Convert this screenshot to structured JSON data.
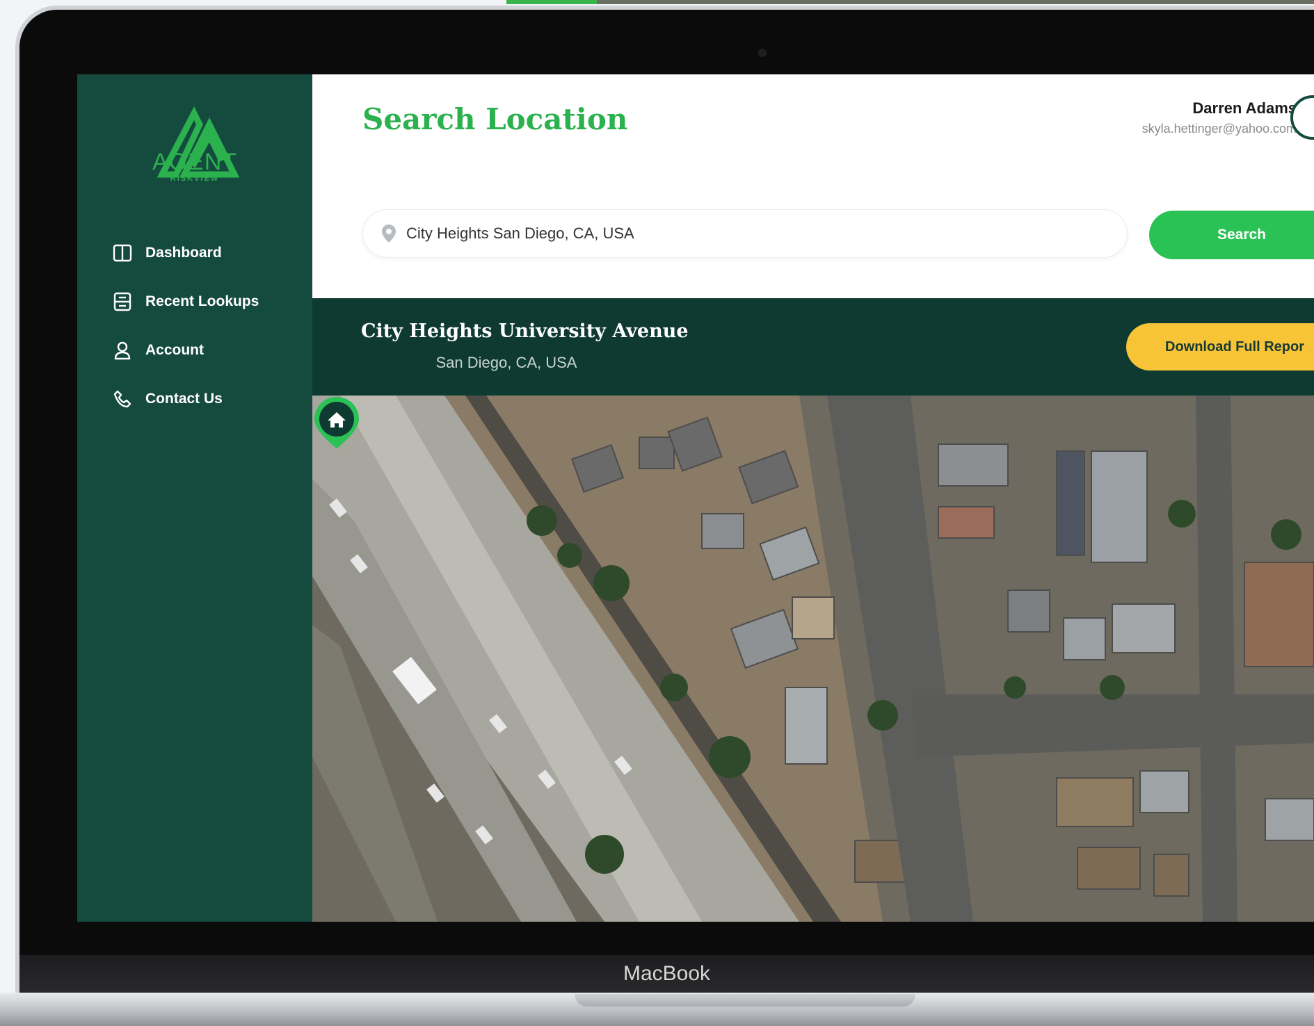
{
  "app": {
    "logo_main": "AGENT",
    "logo_sub": "RISKVIEW",
    "brand_green": "#2ac155",
    "sidebar_color": "#154a3f"
  },
  "sidebar": {
    "items": [
      {
        "label": "Dashboard",
        "icon": "columns-icon"
      },
      {
        "label": "Recent Lookups",
        "icon": "list-icon"
      },
      {
        "label": "Account",
        "icon": "user-icon"
      },
      {
        "label": "Contact Us",
        "icon": "phone-icon"
      }
    ]
  },
  "header": {
    "title": "Search Location",
    "user_name": "Darren Adams",
    "user_email": "skyla.hettinger@yahoo.com"
  },
  "search": {
    "value": "City Heights San Diego, CA, USA",
    "button_label": "Search"
  },
  "location": {
    "title": "City Heights University Avenue",
    "subtitle": "San Diego, CA, USA",
    "download_label": "Download Full Repor"
  },
  "map": {
    "marker_icon": "home-icon"
  },
  "device": {
    "label": "MacBook"
  }
}
